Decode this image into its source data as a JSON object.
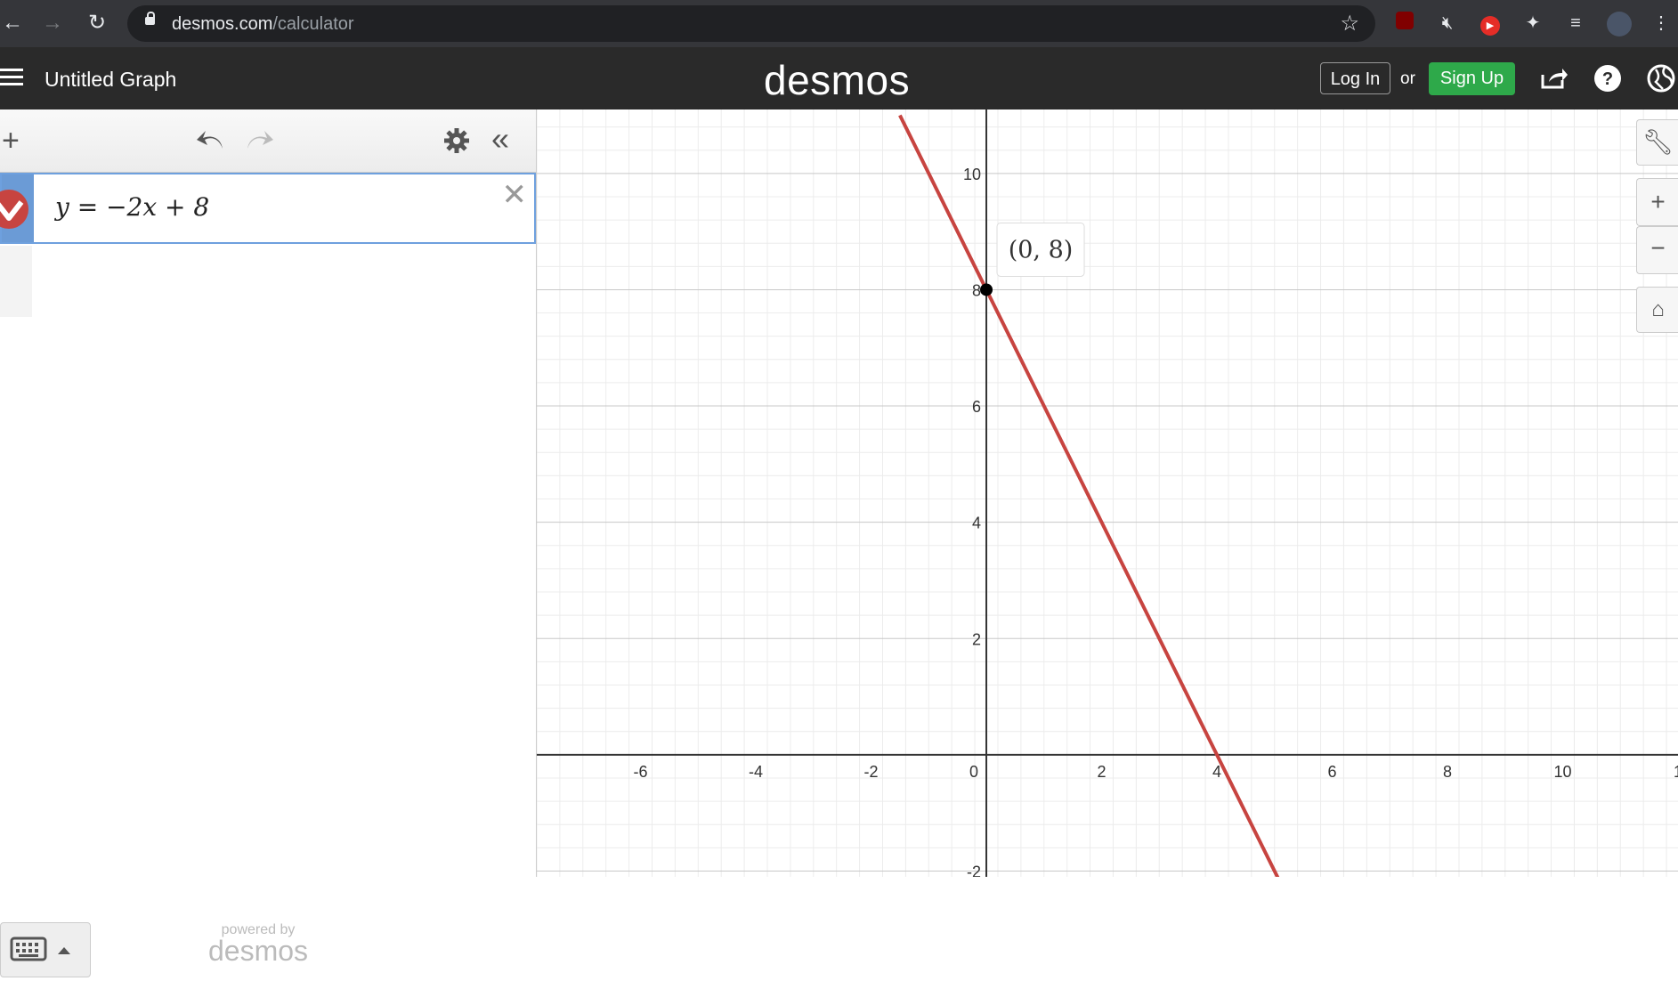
{
  "browser": {
    "url_host": "desmos.com",
    "url_path": "/calculator",
    "extensions": [
      "ublock-icon",
      "mute-icon",
      "youtube-icon",
      "puzzle-icon",
      "playlist-icon",
      "profile-avatar"
    ]
  },
  "app": {
    "title": "Untitled Graph",
    "logo": "desmos",
    "login_label": "Log In",
    "or_label": "or",
    "signup_label": "Sign Up",
    "accent_signup": "#2ea94a"
  },
  "expressions": [
    {
      "latex": "y = −2x + 8",
      "color": "#c74440"
    }
  ],
  "powered_by": {
    "line1": "powered by",
    "line2": "desmos"
  },
  "tooltip": {
    "label": "(0, 8)"
  },
  "chart_data": {
    "type": "line",
    "series": [
      {
        "x": [
          -1.5,
          5.2
        ],
        "y": [
          11,
          -2.4
        ]
      }
    ],
    "point": {
      "x": 0,
      "y": 8
    },
    "xlim": [
      -7.8,
      12
    ],
    "ylim": [
      -2.1,
      11.1
    ],
    "x_ticks": [
      "-6",
      "-4",
      "-2",
      "0",
      "2",
      "4",
      "6",
      "8",
      "10",
      "1"
    ],
    "y_ticks": [
      "10",
      "8",
      "6",
      "4",
      "2",
      "-2"
    ],
    "grid": true
  }
}
